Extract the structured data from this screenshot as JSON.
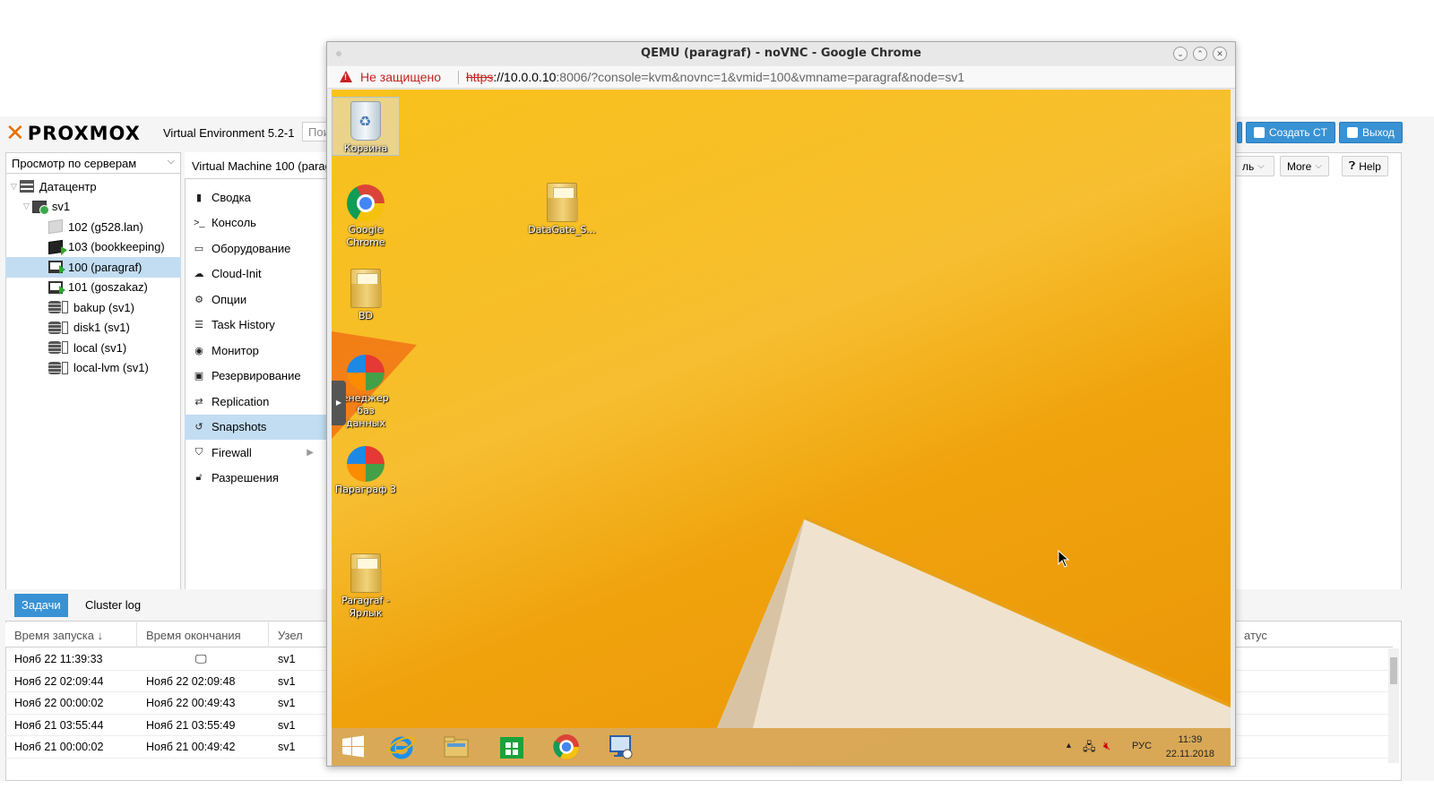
{
  "pve": {
    "logo": "PROXMOX",
    "version": "Virtual Environment 5.2-1",
    "search_placeholder": "Поис",
    "create_ct": "Создать CT",
    "logout": "Выход",
    "view_select": "Просмотр по серверам",
    "tree": [
      {
        "label": "Датацентр",
        "icon": "datacenter-icon"
      },
      {
        "label": "sv1",
        "icon": "node-icon"
      },
      {
        "label": "102 (g528.lan)",
        "icon": "container-icon"
      },
      {
        "label": "103 (bookkeeping)",
        "icon": "container-running-icon"
      },
      {
        "label": "100 (paragraf)",
        "icon": "vm-running-icon"
      },
      {
        "label": "101 (goszakaz)",
        "icon": "vm-running-icon"
      },
      {
        "label": "bakup (sv1)",
        "icon": "storage-icon"
      },
      {
        "label": "disk1 (sv1)",
        "icon": "storage-icon"
      },
      {
        "label": "local (sv1)",
        "icon": "storage-icon"
      },
      {
        "label": "local-lvm (sv1)",
        "icon": "storage-icon"
      }
    ],
    "vm_title": "Virtual Machine 100 (parag",
    "menu": [
      {
        "label": "Сводка",
        "icon": "book-icon"
      },
      {
        "label": "Консоль",
        "icon": "terminal-icon"
      },
      {
        "label": "Оборудование",
        "icon": "desktop-icon"
      },
      {
        "label": "Cloud-Init",
        "icon": "cloud-icon"
      },
      {
        "label": "Опции",
        "icon": "gear-icon"
      },
      {
        "label": "Task History",
        "icon": "list-icon"
      },
      {
        "label": "Монитор",
        "icon": "eye-icon"
      },
      {
        "label": "Резервирование",
        "icon": "floppy-icon"
      },
      {
        "label": "Replication",
        "icon": "retweet-icon"
      },
      {
        "label": "Snapshots",
        "icon": "history-icon"
      },
      {
        "label": "Firewall",
        "icon": "shield-icon"
      },
      {
        "label": "Разрешения",
        "icon": "unlock-icon"
      }
    ],
    "right_buttons": {
      "partial": "ль",
      "more": "More",
      "help": "Help"
    },
    "tabs": {
      "tasks": "Задачи",
      "cluster_log": "Cluster log"
    },
    "columns": {
      "start": "Время запуска ↓",
      "end": "Время окончания",
      "node": "Узел",
      "status": "атус"
    },
    "rows": [
      {
        "start": "Нояб 22 11:39:33",
        "end": "",
        "node": "sv1"
      },
      {
        "start": "Нояб 22 02:09:44",
        "end": "Нояб 22 02:09:48",
        "node": "sv1"
      },
      {
        "start": "Нояб 22 00:00:02",
        "end": "Нояб 22 00:49:43",
        "node": "sv1"
      },
      {
        "start": "Нояб 21 03:55:44",
        "end": "Нояб 21 03:55:49",
        "node": "sv1"
      },
      {
        "start": "Нояб 21 00:00:02",
        "end": "Нояб 21 00:49:42",
        "node": "sv1"
      }
    ]
  },
  "chrome": {
    "title": "QEMU (paragraf) - noVNC - Google Chrome",
    "not_secure": "Не защищено",
    "url_scheme": "https",
    "url_host": "://10.0.0.10",
    "url_rest": ":8006/?console=kvm&novnc=1&vmid=100&vmname=paragraf&node=sv1"
  },
  "desktop": {
    "icons": [
      {
        "label": "Корзина",
        "type": "recycle-bin"
      },
      {
        "label": "Google Chrome",
        "type": "chrome"
      },
      {
        "label": "DataGate_S...",
        "type": "folder"
      },
      {
        "label": "BD",
        "type": "folder"
      },
      {
        "label": "Менеджер баз данных",
        "type": "paragraf-app"
      },
      {
        "label": "Параграф 3",
        "type": "paragraf-app"
      },
      {
        "label": "Paragraf - Ярлык",
        "type": "folder"
      }
    ],
    "tray_lang": "РУС",
    "clock_time": "11:39",
    "clock_date": "22.11.2018"
  }
}
